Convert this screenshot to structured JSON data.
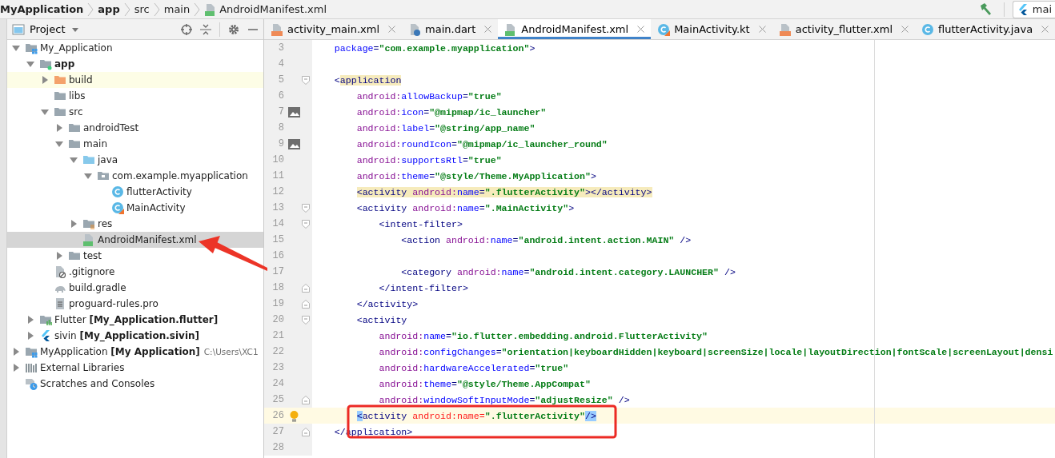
{
  "breadcrumb": [
    {
      "label": "MyApplication",
      "kind": "project"
    },
    {
      "label": "app",
      "kind": "module"
    },
    {
      "label": "src",
      "kind": "folder"
    },
    {
      "label": "main",
      "kind": "folder"
    },
    {
      "label": "AndroidManifest.xml",
      "kind": "manifest"
    }
  ],
  "branch": {
    "label": "mai"
  },
  "project_panel": {
    "title": "Project",
    "tree": [
      {
        "label": "My_Application",
        "kind": "project",
        "expanded": true,
        "selected": false,
        "highlighted": false,
        "children": [
          {
            "label": "app",
            "kind": "module",
            "expanded": true,
            "selected": false,
            "highlighted": false,
            "children": [
              {
                "label": "build",
                "kind": "build-folder",
                "expanded": false,
                "selected": false,
                "highlighted": true
              },
              {
                "label": "libs",
                "kind": "folder",
                "selected": false,
                "highlighted": false
              },
              {
                "label": "src",
                "kind": "folder",
                "expanded": true,
                "selected": false,
                "highlighted": false,
                "children": [
                  {
                    "label": "androidTest",
                    "kind": "folder",
                    "expanded": false,
                    "selected": false,
                    "highlighted": false
                  },
                  {
                    "label": "main",
                    "kind": "folder",
                    "expanded": true,
                    "selected": false,
                    "highlighted": false,
                    "children": [
                      {
                        "label": "java",
                        "kind": "source-folder",
                        "expanded": true,
                        "selected": false,
                        "highlighted": false,
                        "children": [
                          {
                            "label": "com.example.myapplication",
                            "kind": "package",
                            "expanded": true,
                            "selected": false,
                            "highlighted": false,
                            "children": [
                              {
                                "label": "flutterActivity",
                                "kind": "class",
                                "selected": false,
                                "highlighted": false
                              },
                              {
                                "label": "MainActivity",
                                "kind": "kotlin-class",
                                "selected": false,
                                "highlighted": false
                              }
                            ]
                          }
                        ]
                      },
                      {
                        "label": "res",
                        "kind": "res-folder",
                        "expanded": false,
                        "selected": false,
                        "highlighted": false
                      },
                      {
                        "label": "AndroidManifest.xml",
                        "kind": "manifest",
                        "selected": true,
                        "highlighted": false
                      }
                    ]
                  },
                  {
                    "label": "test",
                    "kind": "folder",
                    "expanded": false,
                    "selected": false,
                    "highlighted": false
                  }
                ]
              },
              {
                "label": ".gitignore",
                "kind": "ignore-file",
                "selected": false,
                "highlighted": false
              },
              {
                "label": "build.gradle",
                "kind": "gradle",
                "selected": false,
                "highlighted": false
              },
              {
                "label": "proguard-rules.pro",
                "kind": "text-file",
                "selected": false,
                "highlighted": false
              }
            ]
          },
          {
            "label": "Flutter **[My_Application.flutter]**",
            "kind": "flutter-module",
            "expanded": false,
            "selected": false,
            "highlighted": false
          },
          {
            "label": "sivin **[My_Application.sivin]**",
            "kind": "flutter",
            "expanded": false,
            "selected": false,
            "highlighted": false
          }
        ]
      },
      {
        "label": "MyApplication **[My Application]**",
        "hint": "C:\\Users\\XC1",
        "kind": "project",
        "expanded": false,
        "selected": false,
        "highlighted": false
      },
      {
        "label": "External Libraries",
        "kind": "libraries",
        "expanded": false,
        "selected": false,
        "highlighted": false
      },
      {
        "label": "Scratches and Consoles",
        "kind": "scratches",
        "selected": false,
        "highlighted": false
      }
    ]
  },
  "tabs": [
    {
      "label": "activity_main.xml",
      "kind": "layout-xml",
      "selected": false
    },
    {
      "label": "main.dart",
      "kind": "dart",
      "selected": false
    },
    {
      "label": "AndroidManifest.xml",
      "kind": "manifest",
      "selected": true
    },
    {
      "label": "MainActivity.kt",
      "kind": "kotlin-class",
      "selected": false
    },
    {
      "label": "activity_flutter.xml",
      "kind": "layout-xml",
      "selected": false
    },
    {
      "label": "flutterActivity.java",
      "kind": "class",
      "selected": false
    }
  ],
  "code_lines": [
    {
      "number": "3",
      "current": false,
      "tokens": [
        {
          "kind": "attr",
          "text": "    package"
        },
        {
          "kind": "punct",
          "text": "="
        },
        {
          "kind": "value",
          "text": "\"com.example.myapplication\""
        },
        {
          "kind": "punct",
          "text": ">"
        }
      ]
    },
    {
      "number": "4",
      "current": false
    },
    {
      "number": "5",
      "current": false,
      "fold": {
        "kind": "open"
      },
      "tokens": [
        {
          "kind": "punct",
          "text": "    <"
        },
        {
          "kind": "tag",
          "text": "application",
          "highlight": {
            "kind": "match"
          }
        }
      ]
    },
    {
      "number": "6",
      "current": false,
      "tokens": [
        {
          "kind": "ns",
          "text": "        android:"
        },
        {
          "kind": "attr",
          "text": "allowBackup"
        },
        {
          "kind": "punct",
          "text": "="
        },
        {
          "kind": "value",
          "text": "\"true\""
        }
      ]
    },
    {
      "number": "7",
      "current": false,
      "gutter": {
        "kind": "image"
      },
      "tokens": [
        {
          "kind": "ns",
          "text": "        android:"
        },
        {
          "kind": "attr",
          "text": "icon"
        },
        {
          "kind": "punct",
          "text": "="
        },
        {
          "kind": "value",
          "text": "\"@mipmap/ic_launcher\""
        }
      ]
    },
    {
      "number": "8",
      "current": false,
      "tokens": [
        {
          "kind": "ns",
          "text": "        android:"
        },
        {
          "kind": "attr",
          "text": "label"
        },
        {
          "kind": "punct",
          "text": "="
        },
        {
          "kind": "value",
          "text": "\"@string/app_name\""
        }
      ]
    },
    {
      "number": "9",
      "current": false,
      "gutter": {
        "kind": "image"
      },
      "tokens": [
        {
          "kind": "ns",
          "text": "        android:"
        },
        {
          "kind": "attr",
          "text": "roundIcon"
        },
        {
          "kind": "punct",
          "text": "="
        },
        {
          "kind": "value",
          "text": "\"@mipmap/ic_launcher_round\""
        }
      ]
    },
    {
      "number": "10",
      "current": false,
      "tokens": [
        {
          "kind": "ns",
          "text": "        android:"
        },
        {
          "kind": "attr",
          "text": "supportsRtl"
        },
        {
          "kind": "punct",
          "text": "="
        },
        {
          "kind": "value",
          "text": "\"true\""
        }
      ]
    },
    {
      "number": "11",
      "current": false,
      "tokens": [
        {
          "kind": "ns",
          "text": "        android:"
        },
        {
          "kind": "attr",
          "text": "theme"
        },
        {
          "kind": "punct",
          "text": "="
        },
        {
          "kind": "value",
          "text": "\"@style/Theme.MyApplication\""
        },
        {
          "kind": "punct",
          "text": ">"
        }
      ]
    },
    {
      "number": "12",
      "current": false,
      "tokens": [
        {
          "kind": "punct",
          "text": "        <",
          "highlight": {
            "kind": "match"
          }
        },
        {
          "kind": "tag",
          "text": "activity ",
          "highlight": {
            "kind": "match"
          }
        },
        {
          "kind": "ns",
          "text": "android:",
          "highlight": {
            "kind": "match"
          }
        },
        {
          "kind": "attr",
          "text": "name",
          "highlight": {
            "kind": "match"
          }
        },
        {
          "kind": "punct",
          "text": "=",
          "highlight": {
            "kind": "match"
          }
        },
        {
          "kind": "value",
          "text": "\".flutterActivity\"",
          "highlight": {
            "kind": "match"
          }
        },
        {
          "kind": "punct",
          "text": "></",
          "highlight": {
            "kind": "match"
          }
        },
        {
          "kind": "tag",
          "text": "activity",
          "highlight": {
            "kind": "match"
          }
        },
        {
          "kind": "punct",
          "text": ">",
          "highlight": {
            "kind": "match"
          }
        }
      ]
    },
    {
      "number": "13",
      "current": false,
      "fold": {
        "kind": "open"
      },
      "tokens": [
        {
          "kind": "punct",
          "text": "        <"
        },
        {
          "kind": "tag",
          "text": "activity "
        },
        {
          "kind": "ns",
          "text": "android:"
        },
        {
          "kind": "attr",
          "text": "name"
        },
        {
          "kind": "punct",
          "text": "="
        },
        {
          "kind": "value",
          "text": "\".MainActivity\""
        },
        {
          "kind": "punct",
          "text": ">"
        }
      ]
    },
    {
      "number": "14",
      "current": false,
      "fold": {
        "kind": "open"
      },
      "tokens": [
        {
          "kind": "punct",
          "text": "            <"
        },
        {
          "kind": "tag",
          "text": "intent-filter"
        },
        {
          "kind": "punct",
          "text": ">"
        }
      ]
    },
    {
      "number": "15",
      "current": false,
      "tokens": [
        {
          "kind": "punct",
          "text": "                <"
        },
        {
          "kind": "tag",
          "text": "action "
        },
        {
          "kind": "ns",
          "text": "android:"
        },
        {
          "kind": "attr",
          "text": "name"
        },
        {
          "kind": "punct",
          "text": "="
        },
        {
          "kind": "value",
          "text": "\"android.intent.action.MAIN\""
        },
        {
          "kind": "punct",
          "text": " />"
        }
      ]
    },
    {
      "number": "16",
      "current": false
    },
    {
      "number": "17",
      "current": false,
      "tokens": [
        {
          "kind": "punct",
          "text": "                <"
        },
        {
          "kind": "tag",
          "text": "category "
        },
        {
          "kind": "ns",
          "text": "android:"
        },
        {
          "kind": "attr",
          "text": "name"
        },
        {
          "kind": "punct",
          "text": "="
        },
        {
          "kind": "value",
          "text": "\"android.intent.category.LAUNCHER\""
        },
        {
          "kind": "punct",
          "text": " />"
        }
      ]
    },
    {
      "number": "18",
      "current": false,
      "fold": {
        "kind": "close"
      },
      "tokens": [
        {
          "kind": "punct",
          "text": "            </"
        },
        {
          "kind": "tag",
          "text": "intent-filter"
        },
        {
          "kind": "punct",
          "text": ">"
        }
      ]
    },
    {
      "number": "19",
      "current": false,
      "fold": {
        "kind": "close"
      },
      "tokens": [
        {
          "kind": "punct",
          "text": "        </"
        },
        {
          "kind": "tag",
          "text": "activity"
        },
        {
          "kind": "punct",
          "text": ">"
        }
      ]
    },
    {
      "number": "20",
      "current": false,
      "fold": {
        "kind": "open"
      },
      "tokens": [
        {
          "kind": "punct",
          "text": "        <"
        },
        {
          "kind": "tag",
          "text": "activity"
        }
      ]
    },
    {
      "number": "21",
      "current": false,
      "tokens": [
        {
          "kind": "ns",
          "text": "            android:"
        },
        {
          "kind": "attr",
          "text": "name"
        },
        {
          "kind": "punct",
          "text": "="
        },
        {
          "kind": "value",
          "text": "\"io.flutter.embedding.android.FlutterActivity\""
        }
      ]
    },
    {
      "number": "22",
      "current": false,
      "tokens": [
        {
          "kind": "ns",
          "text": "            android:"
        },
        {
          "kind": "attr",
          "text": "configChanges"
        },
        {
          "kind": "punct",
          "text": "="
        },
        {
          "kind": "value",
          "text": "\"orientation|keyboardHidden|keyboard|screenSize|locale|layoutDirection|fontScale|screenLayout|densi"
        }
      ]
    },
    {
      "number": "23",
      "current": false,
      "tokens": [
        {
          "kind": "ns",
          "text": "            android:"
        },
        {
          "kind": "attr",
          "text": "hardwareAccelerated"
        },
        {
          "kind": "punct",
          "text": "="
        },
        {
          "kind": "value",
          "text": "\"true\""
        }
      ]
    },
    {
      "number": "24",
      "current": false,
      "tokens": [
        {
          "kind": "ns",
          "text": "            android:"
        },
        {
          "kind": "attr",
          "text": "theme"
        },
        {
          "kind": "punct",
          "text": "="
        },
        {
          "kind": "value",
          "text": "\"@style/Theme.AppCompat\""
        }
      ]
    },
    {
      "number": "25",
      "current": false,
      "fold": {
        "kind": "close"
      },
      "tokens": [
        {
          "kind": "ns",
          "text": "            android:"
        },
        {
          "kind": "attr",
          "text": "windowSoftInputMode"
        },
        {
          "kind": "punct",
          "text": "="
        },
        {
          "kind": "value",
          "text": "\"adjustResize\""
        },
        {
          "kind": "punct",
          "text": " />"
        }
      ]
    },
    {
      "number": "26",
      "current": true,
      "gutter": {
        "kind": "bulb"
      },
      "tokens": [
        {
          "kind": "punct",
          "text": "        <",
          "highlight": {
            "kind": "brace"
          }
        },
        {
          "kind": "tag",
          "text": "activity "
        },
        {
          "kind": "error",
          "text": "android:name="
        },
        {
          "kind": "value",
          "text": "\".flutterActivity\""
        },
        {
          "kind": "punct",
          "text": "/>",
          "highlight": {
            "kind": "brace"
          }
        }
      ]
    },
    {
      "number": "27",
      "current": false,
      "fold": {
        "kind": "close"
      },
      "tokens": [
        {
          "kind": "punct",
          "text": "    </"
        },
        {
          "kind": "tag",
          "text": "application"
        },
        {
          "kind": "punct",
          "text": ">"
        }
      ]
    },
    {
      "number": "28",
      "current": false
    }
  ]
}
